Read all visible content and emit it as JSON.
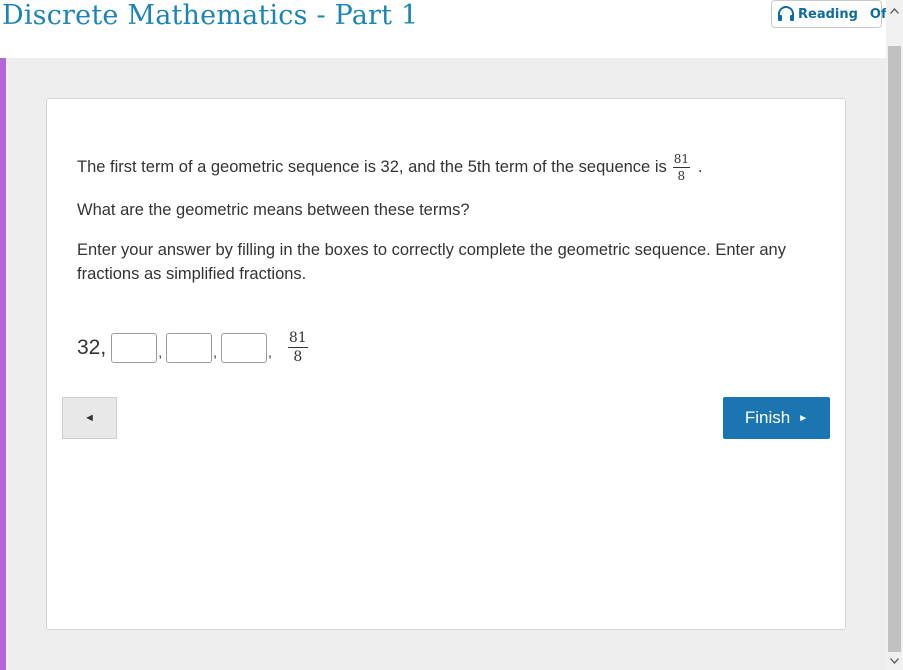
{
  "header": {
    "title": "Discrete Mathematics - Part 1",
    "reading_label": "Reading",
    "reading_state": "Off"
  },
  "question": {
    "line1": "The first term of a geometric sequence is 32, and the 5th term of the sequence is",
    "fifth_term": {
      "numerator": "81",
      "denominator": "8"
    },
    "line1_end": ".",
    "line2": "What are the geometric means between these terms?",
    "instructions_1": "Enter your answer by filling in the boxes to correctly complete the geometric sequence. Enter any",
    "instructions_2": "fractions as simplified fractions."
  },
  "answer": {
    "first_term": "32,",
    "separator": ",",
    "boxes": [
      {
        "value": ""
      },
      {
        "value": ""
      },
      {
        "value": ""
      }
    ],
    "last_term": {
      "numerator": "81",
      "denominator": "8"
    }
  },
  "nav": {
    "back_icon": "◄",
    "finish_label": "Finish",
    "finish_icon": "►"
  },
  "colors": {
    "title": "#1a85b5",
    "accent_bar": "#b266d9",
    "finish_button": "#1a75b1",
    "background": "#eeeeee"
  }
}
